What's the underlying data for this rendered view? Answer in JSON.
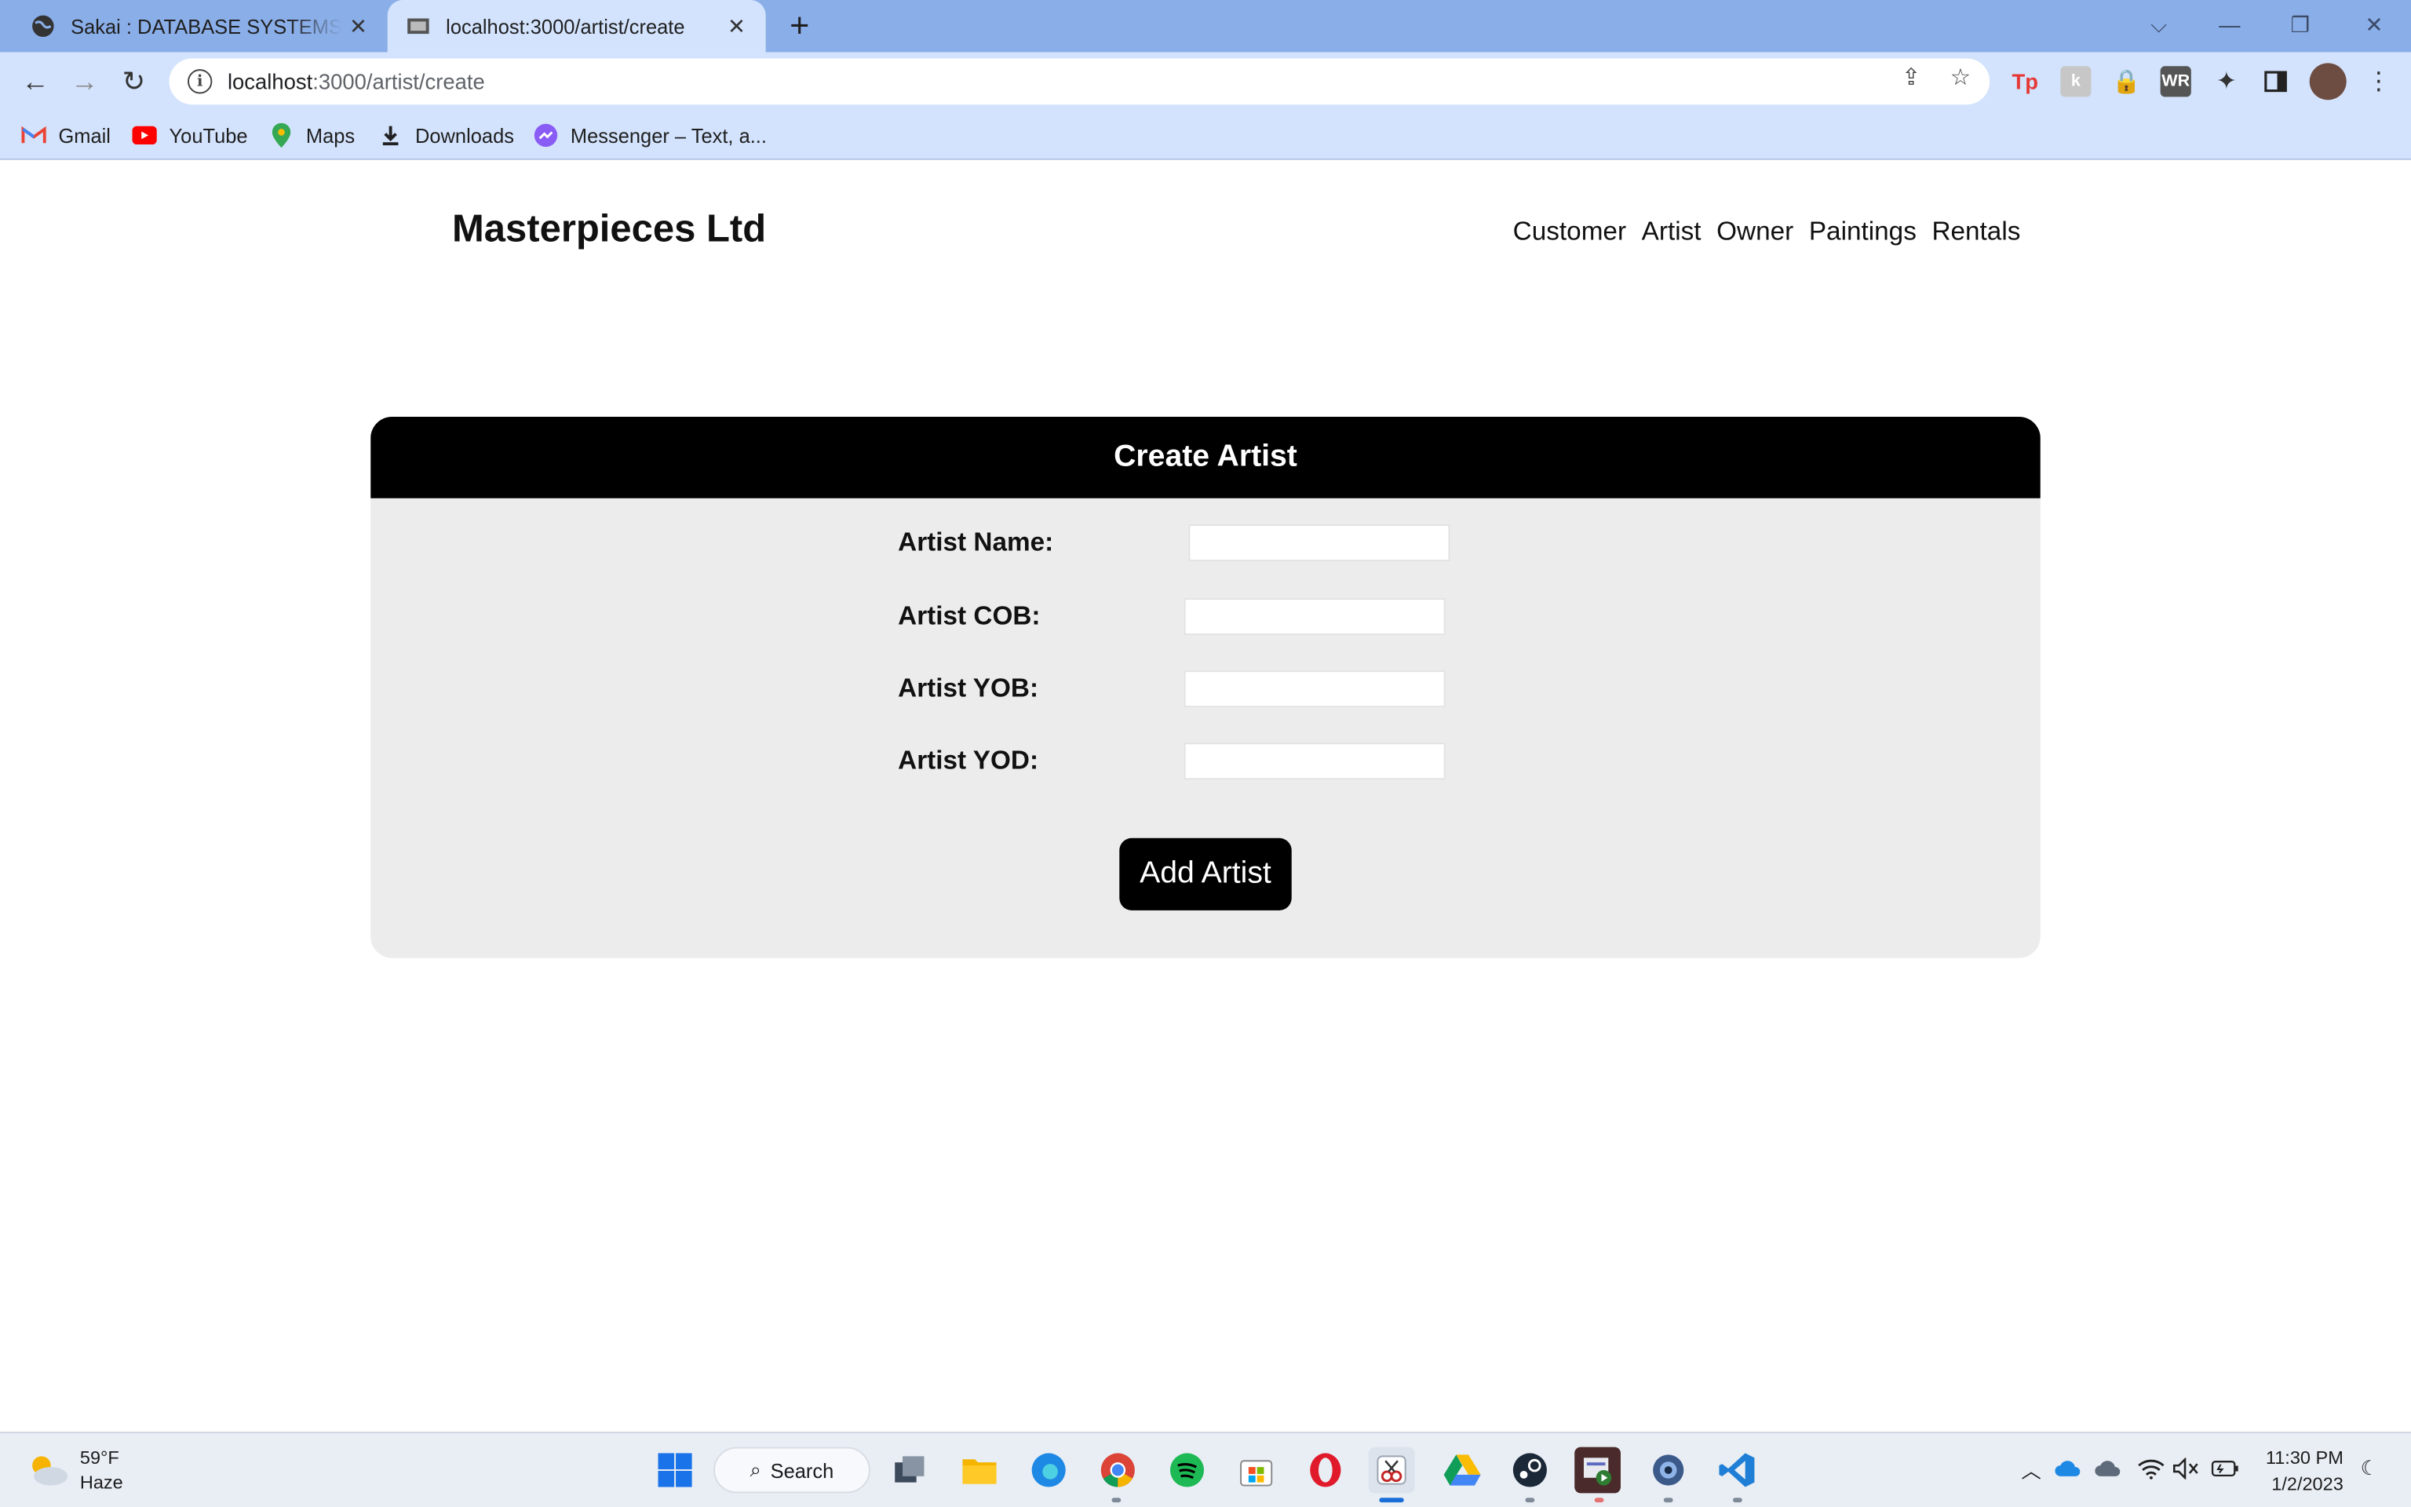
{
  "browser": {
    "tabs": [
      {
        "title": "Sakai : DATABASE SYSTEMS (Class",
        "active": false
      },
      {
        "title": "localhost:3000/artist/create",
        "active": true
      }
    ],
    "new_tab_label": "+",
    "url_host": "localhost",
    "url_rest": ":3000/artist/create",
    "bookmarks": [
      {
        "label": "Gmail",
        "icon": "gmail-icon"
      },
      {
        "label": "YouTube",
        "icon": "youtube-icon"
      },
      {
        "label": "Maps",
        "icon": "maps-icon"
      },
      {
        "label": "Downloads",
        "icon": "download-icon"
      },
      {
        "label": "Messenger – Text, a...",
        "icon": "messenger-icon"
      }
    ]
  },
  "page": {
    "brand": "Masterpieces Ltd",
    "nav": [
      "Customer",
      "Artist",
      "Owner",
      "Paintings",
      "Rentals"
    ],
    "form": {
      "title": "Create Artist",
      "fields": [
        {
          "label": "Artist Name:",
          "value": ""
        },
        {
          "label": "Artist COB:",
          "value": ""
        },
        {
          "label": "Artist YOB:",
          "value": ""
        },
        {
          "label": "Artist YOD:",
          "value": ""
        }
      ],
      "submit_label": "Add Artist"
    }
  },
  "taskbar": {
    "weather_temp": "59°F",
    "weather_desc": "Haze",
    "search_label": "Search",
    "time": "11:30 PM",
    "date": "1/2/2023"
  },
  "colors": {
    "tabbar": "#8aaee8",
    "toolbar": "#d3e3fd",
    "card_header": "#000000",
    "card_body": "#ececec",
    "button": "#000000"
  }
}
